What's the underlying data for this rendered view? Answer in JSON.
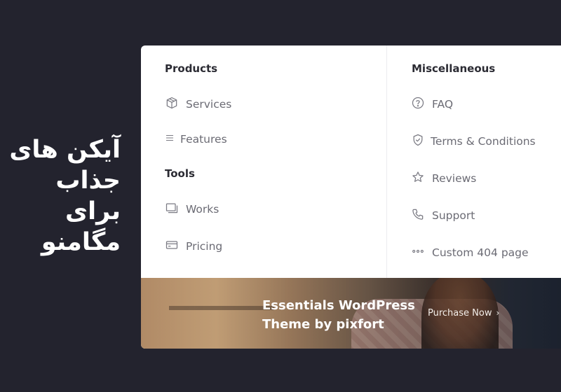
{
  "promo": {
    "lines": [
      "آیکن های",
      "جذاب",
      "برای",
      "مگامنو"
    ]
  },
  "menu": {
    "products": {
      "heading": "Products",
      "items": [
        {
          "label": "Services",
          "icon": "box-icon"
        },
        {
          "label": "Features",
          "icon": "list-icon"
        }
      ]
    },
    "tools": {
      "heading": "Tools",
      "items": [
        {
          "label": "Works",
          "icon": "images-icon"
        },
        {
          "label": "Pricing",
          "icon": "credit-card-icon"
        }
      ]
    },
    "miscellaneous": {
      "heading": "Miscellaneous",
      "items": [
        {
          "label": "FAQ",
          "icon": "question-circle-icon"
        },
        {
          "label": "Terms & Conditions",
          "icon": "shield-check-icon"
        },
        {
          "label": "Reviews",
          "icon": "star-icon"
        },
        {
          "label": "Support",
          "icon": "phone-icon"
        },
        {
          "label": "Custom 404 page",
          "icon": "dots-icon"
        }
      ]
    }
  },
  "banner": {
    "title": "Essentials WordPress Theme by pixfort",
    "cta": "Purchase Now",
    "cta_icon": "chevron-right-icon"
  },
  "colors": {
    "background": "#23232e",
    "panel": "#ffffff",
    "heading": "#2b2b33",
    "item_text": "#6b6b74"
  }
}
